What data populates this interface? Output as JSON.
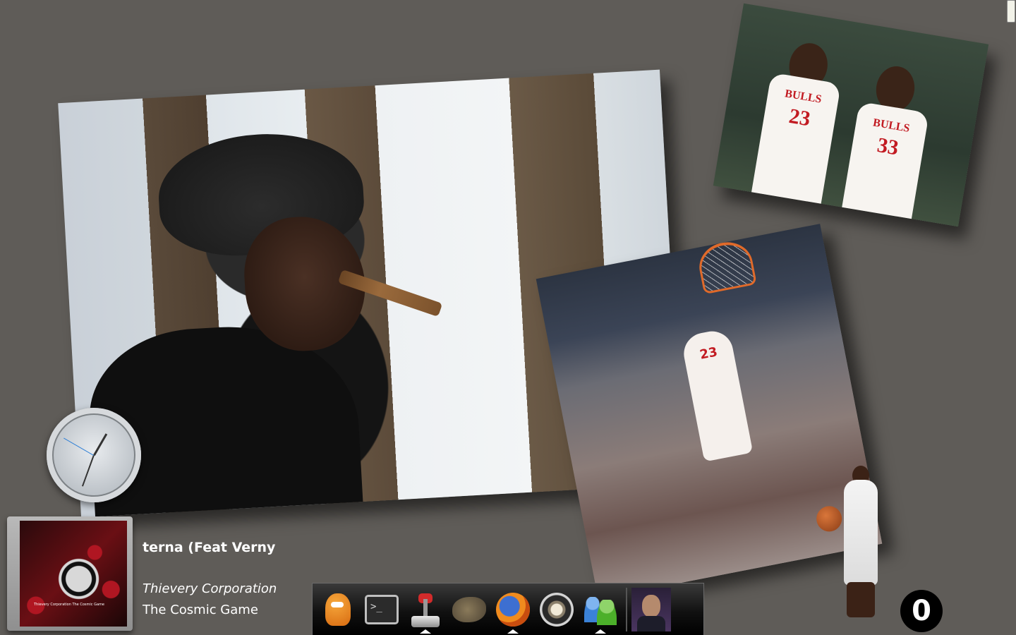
{
  "now_playing": {
    "title": "terna (Feat Verny",
    "artist": "Thievery Corporation",
    "album": "The Cosmic Game",
    "album_art_caption": "Thievery Corporation The Cosmic Game"
  },
  "photos": {
    "dunk_jersey_number": "23",
    "bulls_left_jersey_text": "BULLS",
    "bulls_left_jersey_number": "23",
    "bulls_right_jersey_text": "BULLS",
    "bulls_right_jersey_number": "33"
  },
  "dock": {
    "items": [
      {
        "name": "worms-icon",
        "running": false
      },
      {
        "name": "terminal-icon",
        "glyph": ">_",
        "running": false
      },
      {
        "name": "joystick-icon",
        "running": true
      },
      {
        "name": "gimp-icon",
        "running": false
      },
      {
        "name": "firefox-icon",
        "running": true
      },
      {
        "name": "speaker-icon",
        "running": false
      },
      {
        "name": "messenger-icon",
        "running": true
      },
      {
        "name": "user-avatar",
        "running": false
      }
    ]
  },
  "counter": {
    "value": "0"
  },
  "colors": {
    "desktop_background": "#5f5c58",
    "dock_background": "#111111",
    "text": "#ffffff",
    "bulls_red": "#c21b22"
  }
}
